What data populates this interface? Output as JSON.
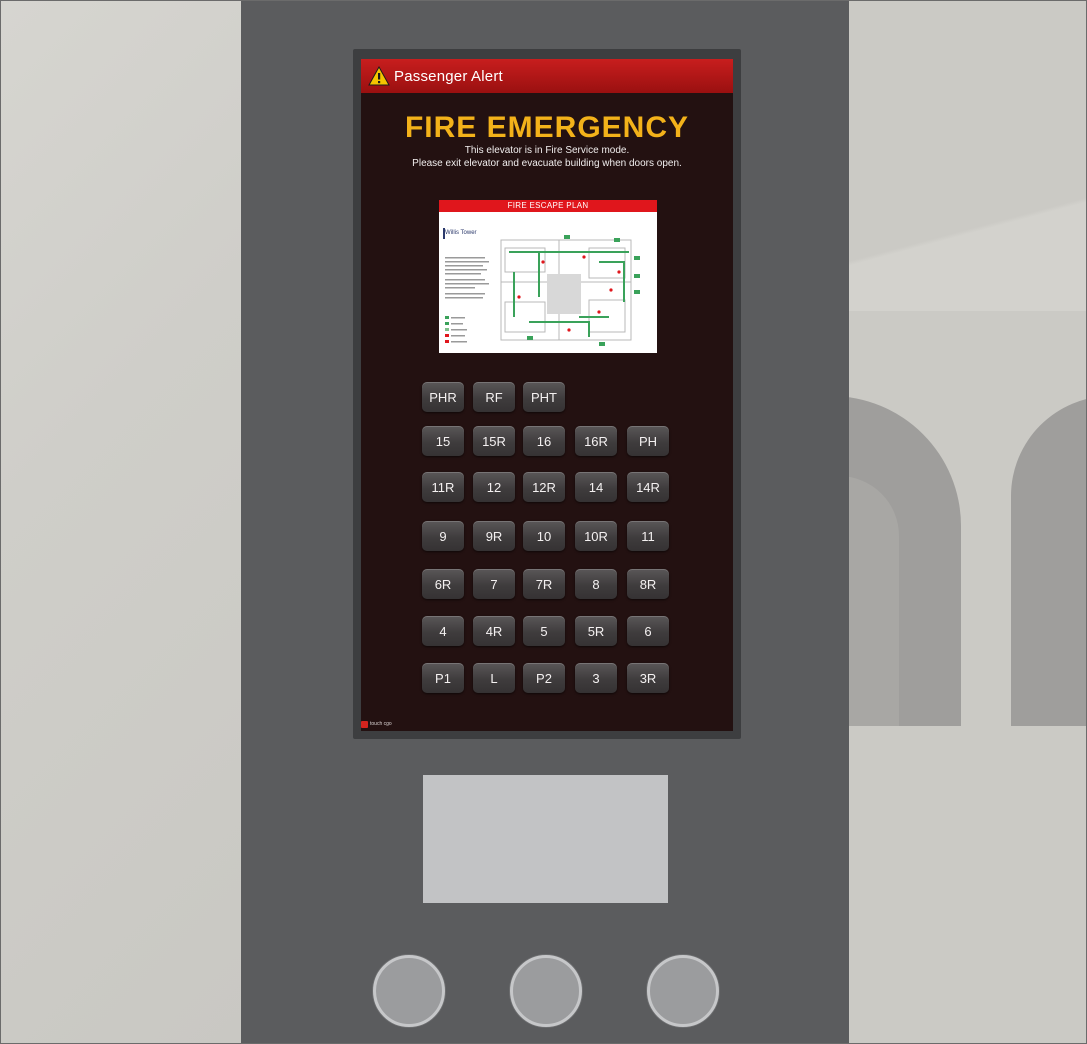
{
  "alert": {
    "title": "Passenger Alert",
    "icon": "warning-triangle-icon"
  },
  "emergency": {
    "headline": "FIRE EMERGENCY",
    "line1": "This elevator is in Fire Service mode.",
    "line2": "Please exit elevator and evacuate building when doors open."
  },
  "plan": {
    "title": "FIRE ESCAPE PLAN",
    "logo_text": "Willis Tower"
  },
  "floor_buttons": [
    [
      "PHR",
      "RF",
      "PHT"
    ],
    [
      "15",
      "15R",
      "16",
      "16R",
      "PH"
    ],
    [
      "11R",
      "12",
      "12R",
      "14",
      "14R"
    ],
    [
      "9",
      "9R",
      "10",
      "10R",
      "11"
    ],
    [
      "6R",
      "7",
      "7R",
      "8",
      "8R"
    ],
    [
      "4",
      "4R",
      "5",
      "5R",
      "6"
    ],
    [
      "P1",
      "L",
      "P2",
      "3",
      "3R"
    ]
  ],
  "brand": {
    "text": "touch cgo"
  },
  "colors": {
    "alert_bar": "#b71515",
    "headline": "#f3b21a",
    "screen_bg": "#231111",
    "panel": "#5b5c5e"
  }
}
